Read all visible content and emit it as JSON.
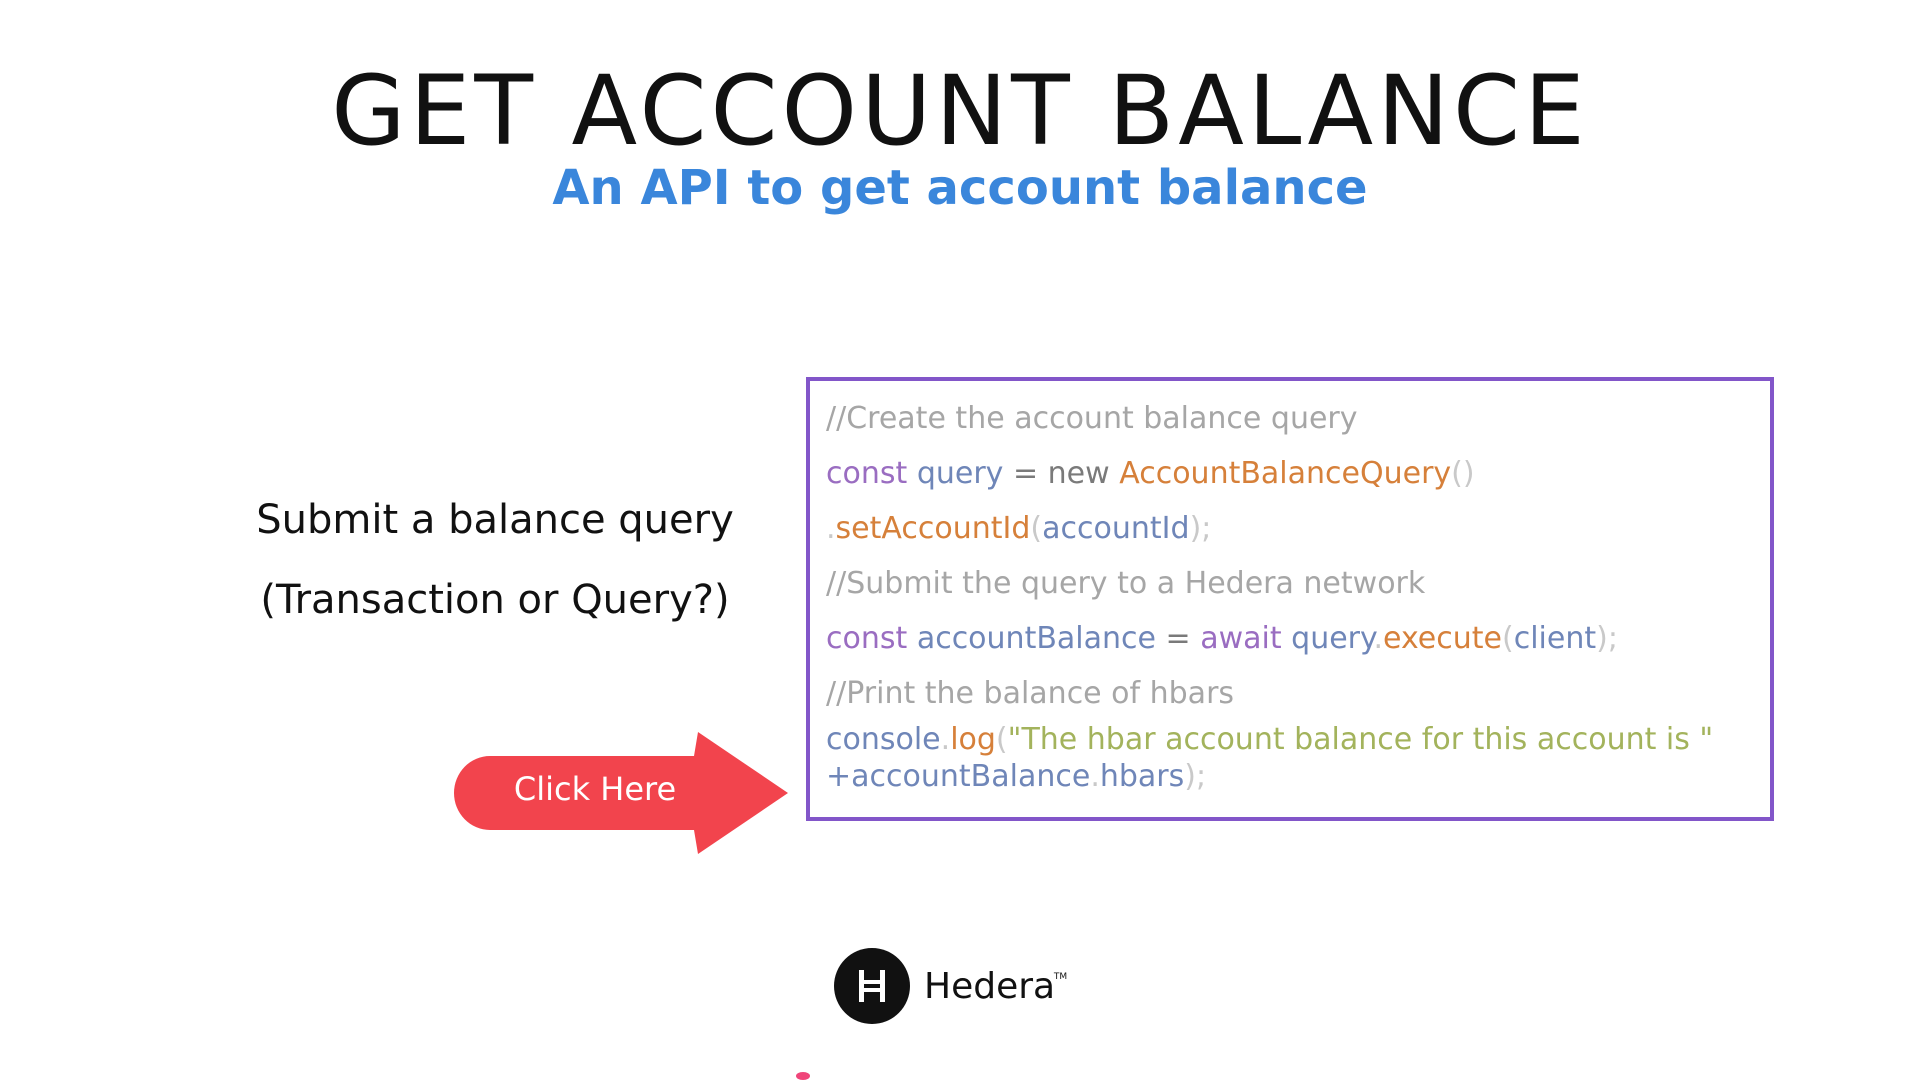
{
  "slide": {
    "title": "GET ACCOUNT BALANCE",
    "subtitle": "An API to get account balance"
  },
  "left": {
    "line1": "Submit a balance query",
    "line2": "(Transaction or Query?)"
  },
  "button": {
    "label": "Click Here",
    "color": "#f2444d"
  },
  "code": {
    "border_color": "#8256c9",
    "comment1": "//Create the account balance query",
    "l2_const": "const",
    "l2_query": "query",
    "l2_eq": "=",
    "l2_new": "new",
    "l2_class": "AccountBalanceQuery",
    "l2_parens": "()",
    "l3_dot": ".",
    "l3_method": "setAccountId",
    "l3_open": "(",
    "l3_arg": "accountId",
    "l3_close": ");",
    "comment2": "//Submit the query to a Hedera network",
    "l5_const": "const",
    "l5_var": "accountBalance",
    "l5_eq": "=",
    "l5_await": "await",
    "l5_query": "query",
    "l5_dot": ".",
    "l5_method": "execute",
    "l5_open": "(",
    "l5_arg": "client",
    "l5_close": ");",
    "comment3": "//Print the balance of hbars",
    "l7_console": "console",
    "l7_dot": ".",
    "l7_log": "log",
    "l7_open": "(",
    "l7_str": "\"The hbar account balance for this account is \"",
    "l8_plus": "+",
    "l8_var": "accountBalance",
    "l8_dot": ".",
    "l8_prop": "hbars",
    "l8_close": ");"
  },
  "logo": {
    "glyph": "H",
    "name": "Hedera",
    "tm": "TM"
  }
}
